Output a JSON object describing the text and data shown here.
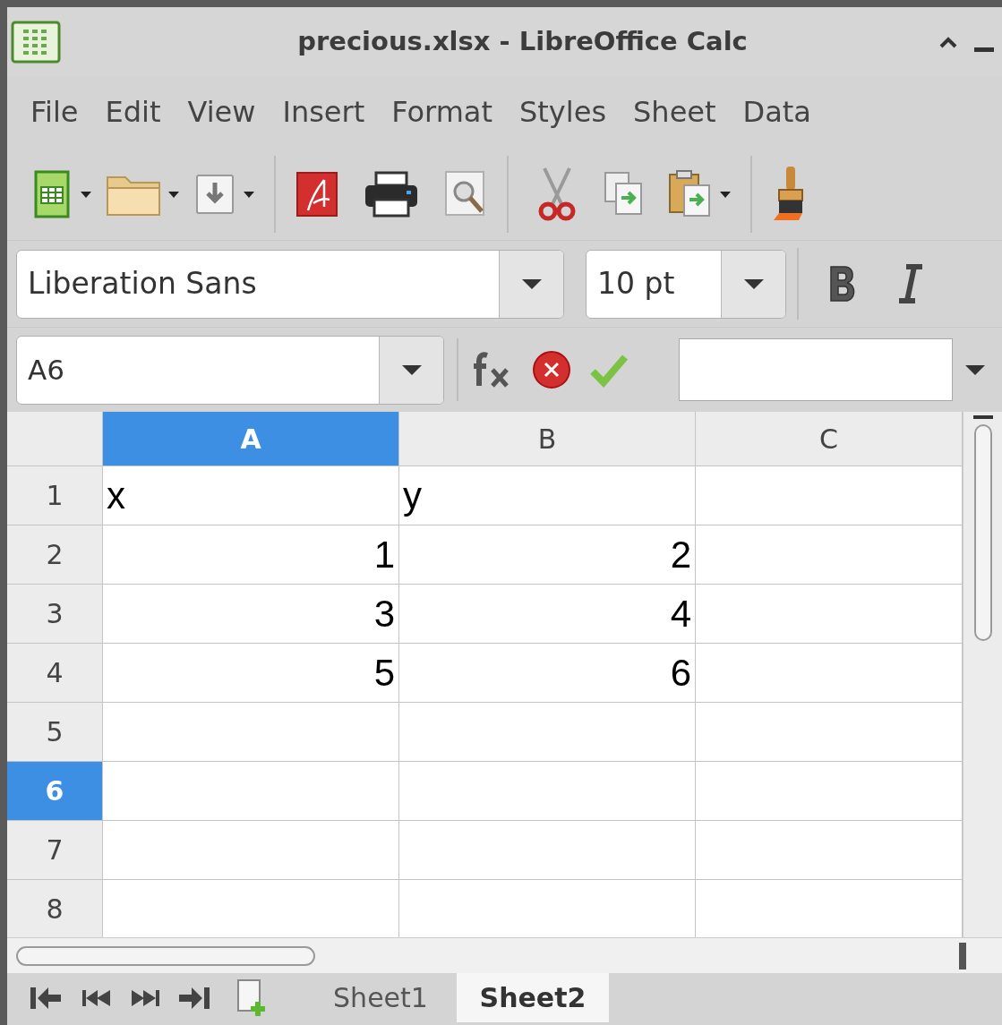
{
  "window": {
    "title": "precious.xlsx - LibreOffice Calc"
  },
  "menu": [
    "File",
    "Edit",
    "View",
    "Insert",
    "Format",
    "Styles",
    "Sheet",
    "Data"
  ],
  "formatting": {
    "font_name": "Liberation Sans",
    "font_size": "10 pt"
  },
  "formula_bar": {
    "name_box": "A6"
  },
  "columns": [
    {
      "label": "A",
      "selected": true
    },
    {
      "label": "B",
      "selected": false
    },
    {
      "label": "C",
      "selected": false
    }
  ],
  "rows": [
    {
      "label": "1",
      "selected": false,
      "cells": [
        {
          "text": "x",
          "kind": "text"
        },
        {
          "text": "y",
          "kind": "text"
        }
      ]
    },
    {
      "label": "2",
      "selected": false,
      "cells": [
        {
          "text": "1",
          "kind": "number"
        },
        {
          "text": "2",
          "kind": "number"
        }
      ]
    },
    {
      "label": "3",
      "selected": false,
      "cells": [
        {
          "text": "3",
          "kind": "number"
        },
        {
          "text": "4",
          "kind": "number"
        }
      ]
    },
    {
      "label": "4",
      "selected": false,
      "cells": [
        {
          "text": "5",
          "kind": "number"
        },
        {
          "text": "6",
          "kind": "number"
        }
      ]
    },
    {
      "label": "5",
      "selected": false
    },
    {
      "label": "6",
      "selected": true
    },
    {
      "label": "7",
      "selected": false
    },
    {
      "label": "8",
      "selected": false
    }
  ],
  "sheet_tabs": [
    {
      "label": "Sheet1",
      "selected": false
    },
    {
      "label": "Sheet2",
      "selected": true
    }
  ]
}
